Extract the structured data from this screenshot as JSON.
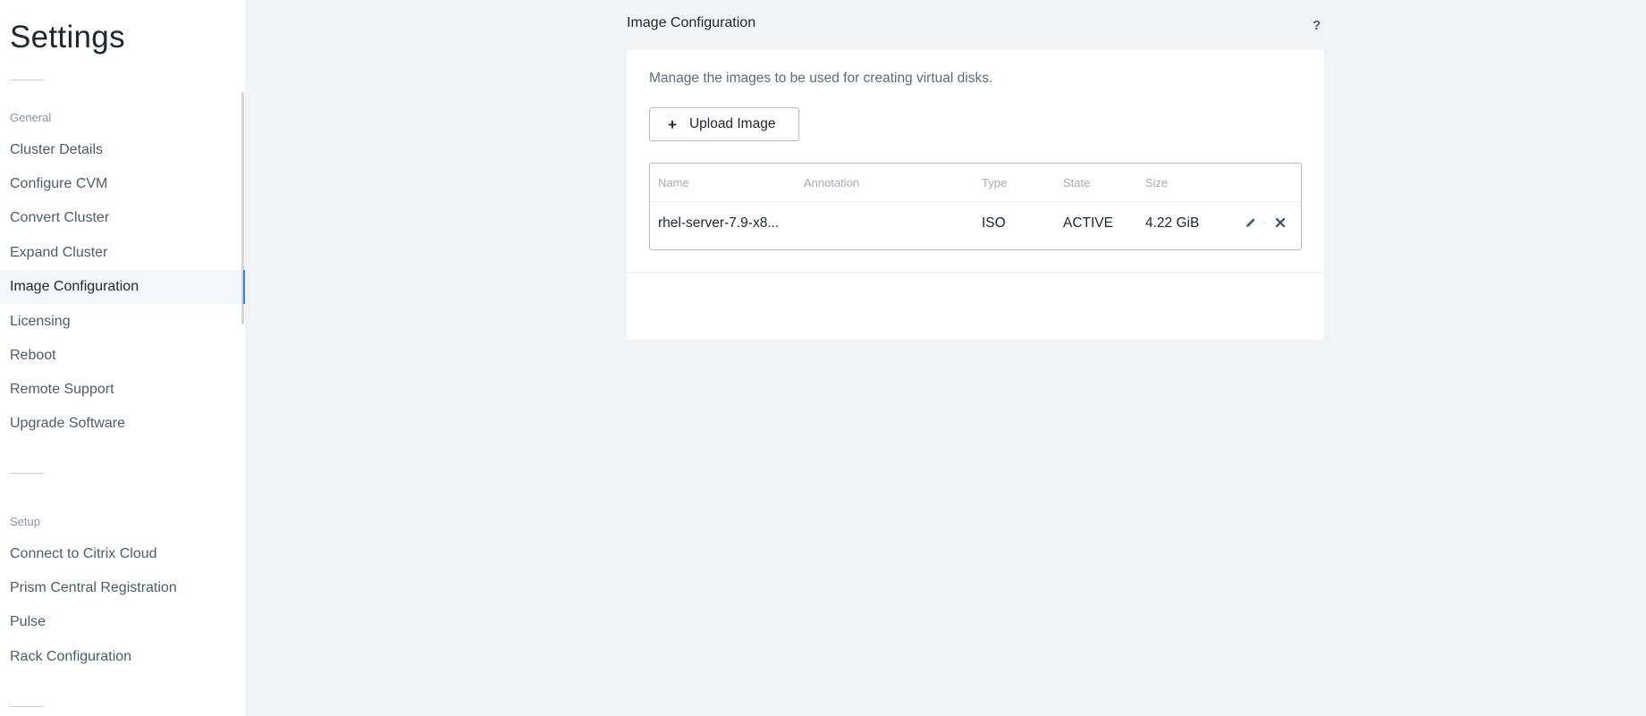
{
  "sidebar": {
    "title": "Settings",
    "sections": [
      {
        "label": "General",
        "items": [
          {
            "label": "Cluster Details"
          },
          {
            "label": "Configure CVM"
          },
          {
            "label": "Convert Cluster"
          },
          {
            "label": "Expand Cluster"
          },
          {
            "label": "Image Configuration",
            "active": true
          },
          {
            "label": "Licensing"
          },
          {
            "label": "Reboot"
          },
          {
            "label": "Remote Support"
          },
          {
            "label": "Upgrade Software"
          }
        ]
      },
      {
        "label": "Setup",
        "items": [
          {
            "label": "Connect to Citrix Cloud"
          },
          {
            "label": "Prism Central Registration"
          },
          {
            "label": "Pulse"
          },
          {
            "label": "Rack Configuration"
          }
        ]
      }
    ],
    "active_item": "Image Configuration"
  },
  "main": {
    "title": "Image Configuration",
    "help_label": "?",
    "description": "Manage the images to be used for creating virtual disks.",
    "upload_button": {
      "icon": "plus-icon",
      "label": "Upload Image"
    },
    "table": {
      "columns": [
        "Name",
        "Annotation",
        "Type",
        "State",
        "Size"
      ],
      "rows": [
        {
          "name": "rhel-server-7.9-x8...",
          "annotation": "",
          "type": "ISO",
          "state": "ACTIVE",
          "size": "4.22 GiB",
          "actions": [
            "pencil-icon",
            "close-icon"
          ]
        }
      ]
    }
  },
  "colors": {
    "background": "#f2f3f5",
    "sidebar_bg": "#ffffff",
    "active_item_bg": "#f3f7fc",
    "accent": "#3b7fd9",
    "text_primary": "#22272e",
    "text_secondary": "#4f5b6b",
    "text_muted": "#a7aeb8"
  }
}
